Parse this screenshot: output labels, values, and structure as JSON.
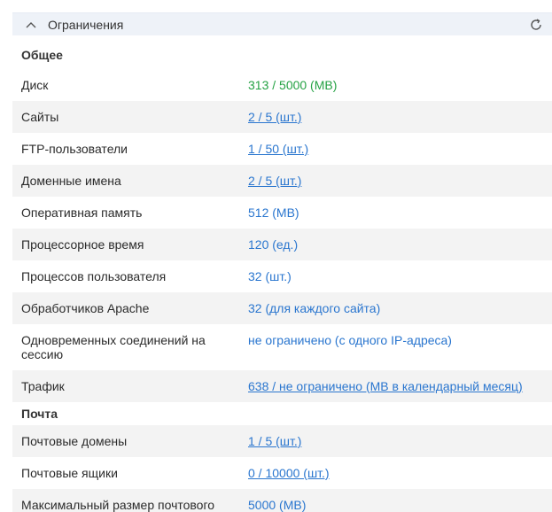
{
  "panel": {
    "title": "Ограничения"
  },
  "sections": {
    "general": "Общее",
    "mail": "Почта"
  },
  "general_rows": [
    {
      "label": "Диск",
      "value": "313 / 5000 (MB)"
    },
    {
      "label": "Сайты",
      "value": "2 / 5 (шт.)"
    },
    {
      "label": "FTP-пользователи",
      "value": "1 / 50 (шт.)"
    },
    {
      "label": "Доменные имена",
      "value": "2 / 5 (шт.)"
    },
    {
      "label": "Оперативная память",
      "value": "512 (MB)"
    },
    {
      "label": "Процессорное время",
      "value": "120 (ед.)"
    },
    {
      "label": "Процессов пользователя",
      "value": "32 (шт.)"
    },
    {
      "label": "Обработчиков Apache",
      "value": "32 (для каждого сайта)"
    },
    {
      "label": "Одновременных соединений на сессию",
      "value": "не ограничено (с одного IP-адреса)"
    },
    {
      "label": "Трафик",
      "value": "638 / не ограничено (MB в календарный месяц)"
    }
  ],
  "mail_rows": [
    {
      "label": "Почтовые домены",
      "value": "1 / 5 (шт.)"
    },
    {
      "label": "Почтовые ящики",
      "value": "0 / 10000 (шт.)"
    },
    {
      "label": "Максимальный размер почтового",
      "value": "5000 (MB)"
    }
  ],
  "colors": {
    "accent": "#2a76cf",
    "ok": "#25a244",
    "row_alt": "#f3f3f3",
    "header_bg": "#eef2f8"
  },
  "icons": {
    "collapse": "chevron-up-icon",
    "refresh": "refresh-icon"
  }
}
